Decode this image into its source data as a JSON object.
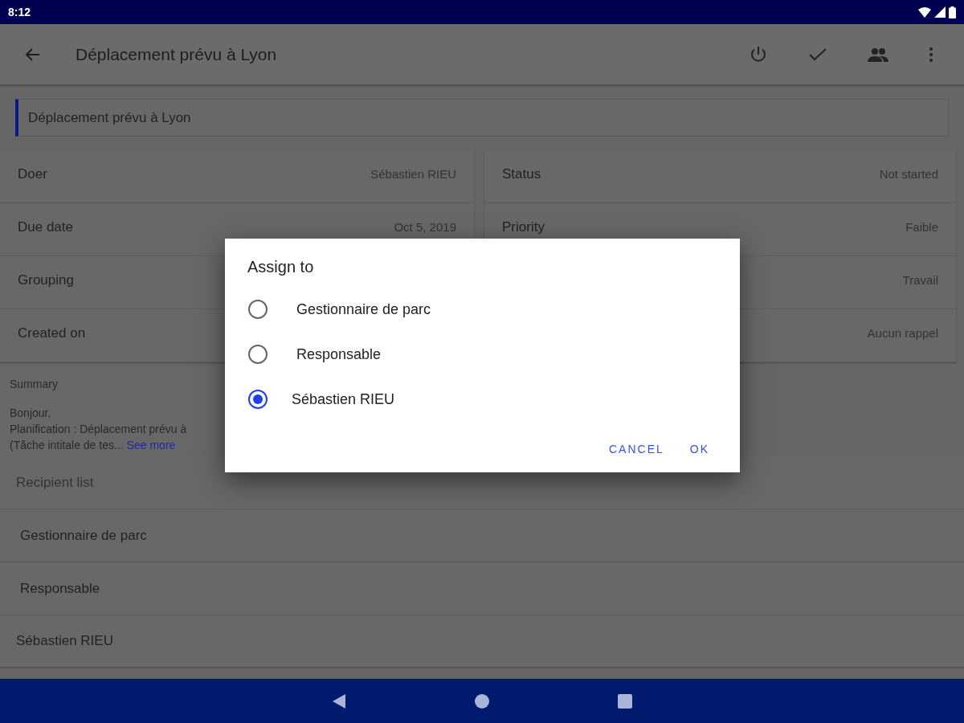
{
  "status_bar": {
    "time": "8:12"
  },
  "app_bar": {
    "title": "Déplacement prévu à Lyon"
  },
  "title_field": {
    "value": "Déplacement prévu à Lyon"
  },
  "details_left": [
    {
      "label": "Doer",
      "value": "Sébastien RIEU"
    },
    {
      "label": "Due date",
      "value": "Oct 5, 2019"
    },
    {
      "label": "Grouping"
    },
    {
      "label": "Created on"
    }
  ],
  "details_right": [
    {
      "label": "Status",
      "value": "Not started"
    },
    {
      "label": "Priority",
      "value": "Faible"
    },
    {
      "value": "Travail"
    },
    {
      "value": "Aucun rappel"
    }
  ],
  "summary": {
    "label": "Summary",
    "lines": [
      "Bonjour,",
      "Planification : Déplacement prévu à",
      "(Tâche intitale de tes..."
    ],
    "link": "See more"
  },
  "recipient_list": {
    "title": "Recipient list",
    "items": [
      "Gestionnaire de parc",
      "Responsable",
      "Sébastien RIEU"
    ]
  },
  "dialog": {
    "title": "Assign to",
    "options": [
      {
        "label": "Gestionnaire de parc",
        "selected": false
      },
      {
        "label": "Responsable",
        "selected": false
      },
      {
        "label": "Sébastien RIEU",
        "selected": true
      }
    ],
    "buttons": [
      "CANCEL",
      "OK"
    ]
  }
}
